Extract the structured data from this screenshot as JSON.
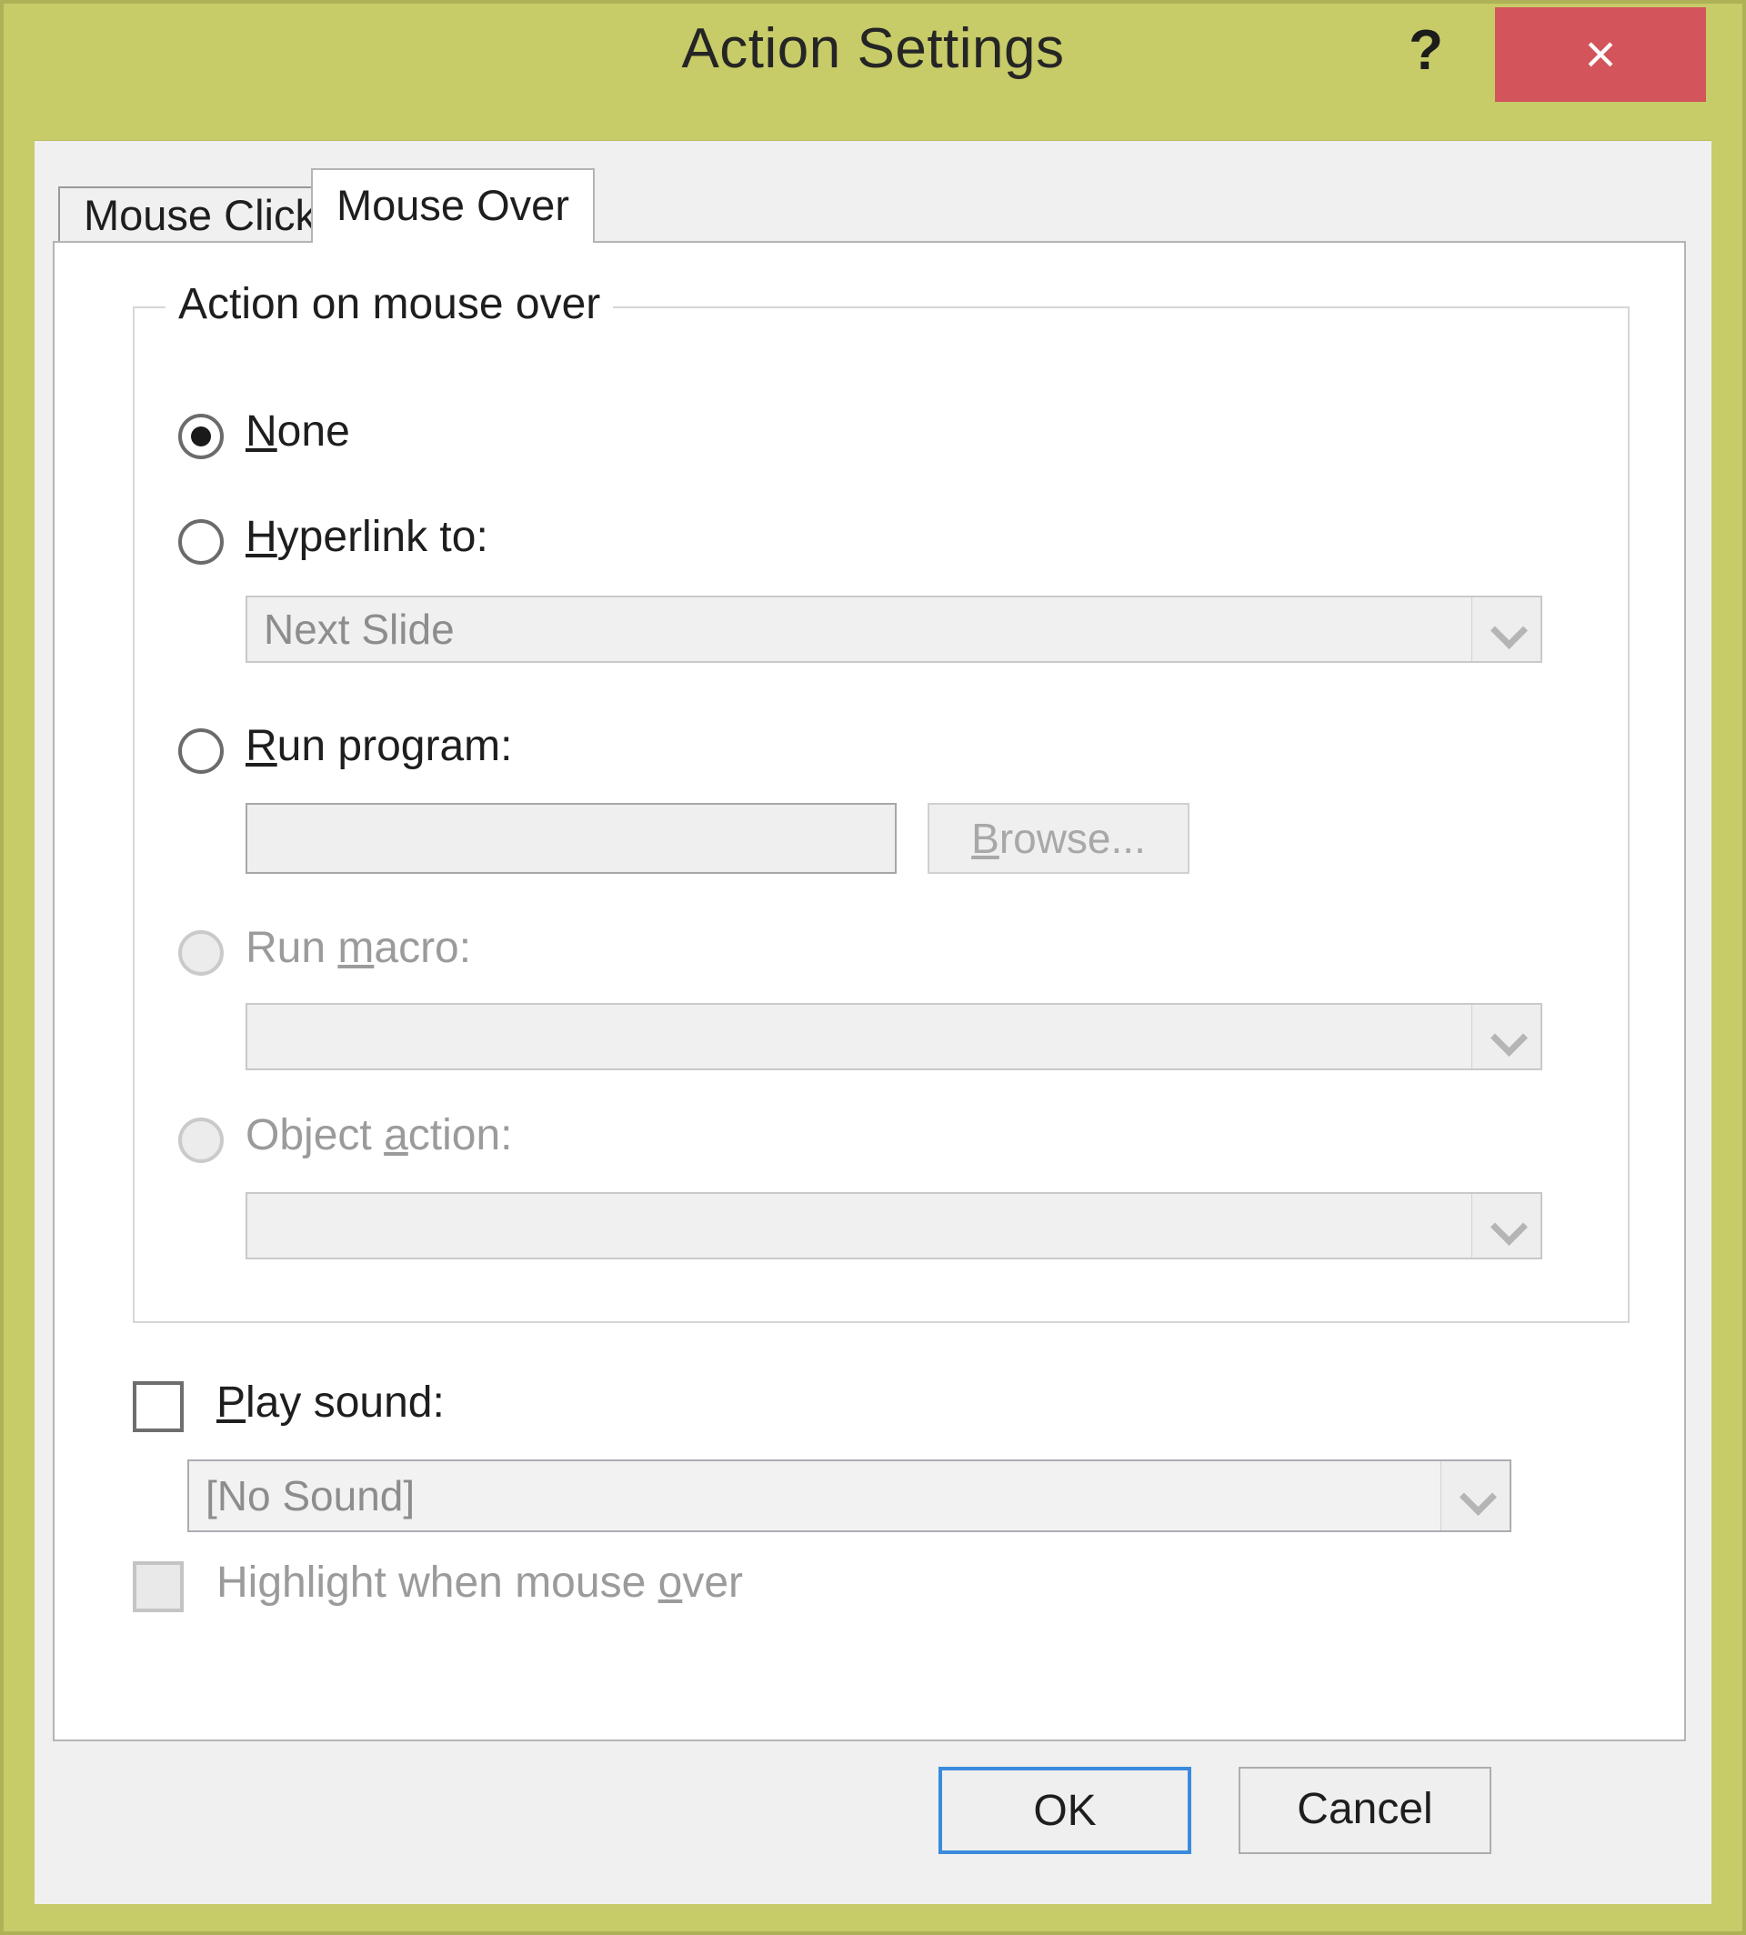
{
  "window": {
    "title": "Action Settings",
    "help_label": "?",
    "close_label": "×",
    "frame_color": "#c7cb68",
    "close_color": "#d3545a",
    "focus_color": "#3a8bdd"
  },
  "tabs": [
    {
      "label": "Mouse Click",
      "active": false
    },
    {
      "label": "Mouse Over",
      "active": true
    }
  ],
  "group": {
    "legend": "Action on mouse over",
    "options": [
      {
        "id": "none",
        "label_pre": "",
        "label_accel": "N",
        "label_post": "one",
        "selected": true,
        "enabled": true
      },
      {
        "id": "hyperlink",
        "label_pre": "",
        "label_accel": "H",
        "label_post": "yperlink to:",
        "selected": false,
        "enabled": true
      },
      {
        "id": "run-program",
        "label_pre": "",
        "label_accel": "R",
        "label_post": "un program:",
        "selected": false,
        "enabled": true
      },
      {
        "id": "run-macro",
        "label_pre": "Run ",
        "label_accel": "m",
        "label_post": "acro:",
        "selected": false,
        "enabled": false
      },
      {
        "id": "object-action",
        "label_pre": "Object ",
        "label_accel": "a",
        "label_post": "ction:",
        "selected": false,
        "enabled": false
      }
    ],
    "hyperlink_combo": {
      "value": "Next Slide",
      "enabled": false
    },
    "program_textbox": {
      "value": "",
      "placeholder": "",
      "enabled": false
    },
    "browse_button": {
      "label_pre": "",
      "label_accel": "B",
      "label_post": "rowse...",
      "enabled": false
    },
    "macro_combo": {
      "value": "",
      "enabled": false
    },
    "object_combo": {
      "value": "",
      "enabled": false
    }
  },
  "sound": {
    "play_sound": {
      "label_pre": "",
      "label_accel": "P",
      "label_post": "lay sound:",
      "checked": false,
      "enabled": true
    },
    "sound_combo": {
      "value": "[No Sound]",
      "enabled": true
    },
    "highlight": {
      "label_pre": "Highlight when mouse ",
      "label_accel": "o",
      "label_post": "ver",
      "checked": false,
      "enabled": false
    }
  },
  "footer": {
    "ok_label": "OK",
    "cancel_label": "Cancel"
  }
}
